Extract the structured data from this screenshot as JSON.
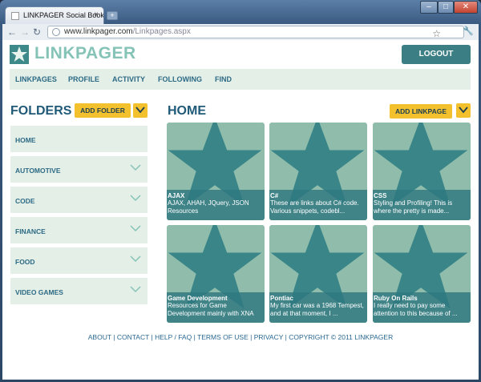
{
  "browser": {
    "tab_title": "LINKPAGER Social Book...",
    "tab_close": "×",
    "newtab": "+",
    "url_host": "www.linkpager.com",
    "url_path": "/Linkpages.aspx",
    "nav_back": "←",
    "nav_forward": "→",
    "nav_reload": "↻",
    "star": "☆",
    "wrench": "🔧",
    "win_min": "–",
    "win_max": "□",
    "win_close": "✕"
  },
  "header": {
    "logo_text": "LINKPAGER",
    "logout_label": "LOGOUT"
  },
  "mainnav": [
    "LINKPAGES",
    "PROFILE",
    "ACTIVITY",
    "FOLLOWING",
    "FIND"
  ],
  "folders": {
    "title": "FOLDERS",
    "add_label": "ADD FOLDER",
    "items": [
      "HOME",
      "AUTOMOTIVE",
      "CODE",
      "FINANCE",
      "FOOD",
      "VIDEO GAMES"
    ]
  },
  "home": {
    "title": "HOME",
    "add_label": "ADD LINKPAGE",
    "cards": [
      {
        "title": "AJAX",
        "desc": "AJAX, AHAH, JQuery, JSON Resources"
      },
      {
        "title": "C#",
        "desc": "These are links about C# code. Various snippets, codebl..."
      },
      {
        "title": "CSS",
        "desc": "Styling and Profiling! This is where the pretty is made..."
      },
      {
        "title": "Game Development",
        "desc": "Resources for Game Development mainly with XNA and Visu..."
      },
      {
        "title": "Pontiac",
        "desc": "My first car was a 1968 Tempest, and at that moment, I ..."
      },
      {
        "title": "Ruby On Rails",
        "desc": "I really need to pay some attention to this because of ..."
      }
    ]
  },
  "footer": [
    "ABOUT",
    "CONTACT",
    "HELP / FAQ",
    "TERMS OF USE",
    "PRIVACY",
    "COPYRIGHT © 2011 LINKPAGER"
  ],
  "footer_sep": " | ",
  "colors": {
    "brand_teal": "#3b7f84",
    "brand_light": "#86c3b7",
    "accent_yellow": "#f3c12d",
    "panel_bg": "#e4efe8",
    "heading_blue": "#205a78"
  }
}
